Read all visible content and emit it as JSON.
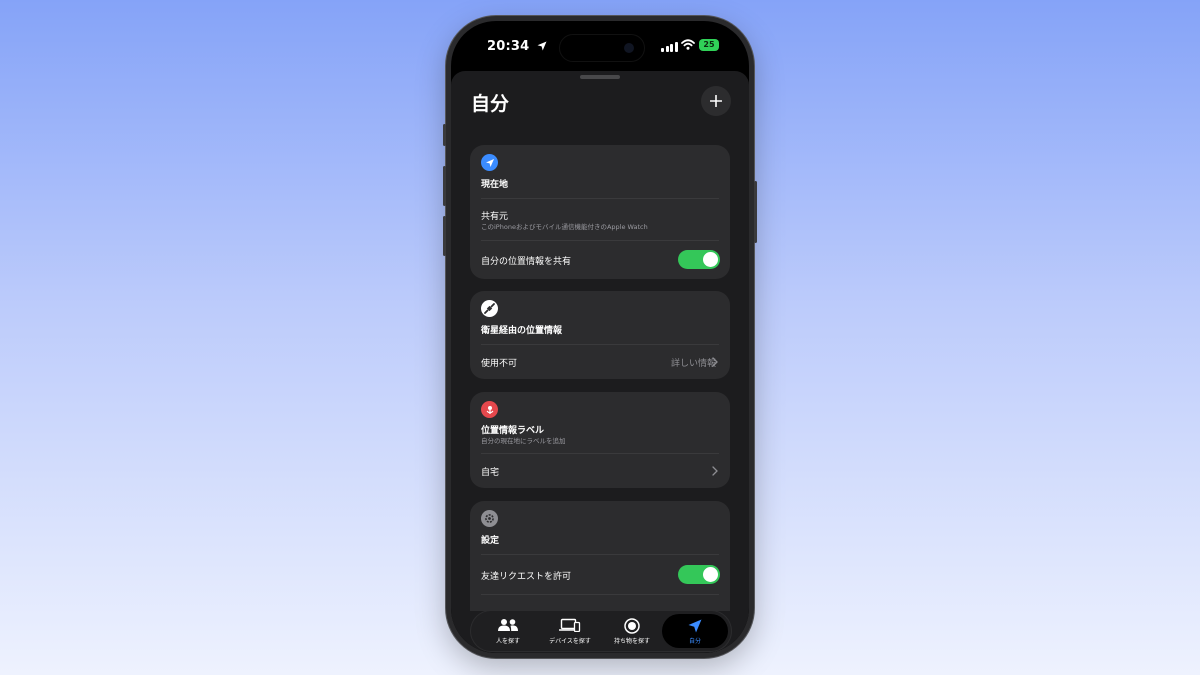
{
  "status_bar": {
    "time": "20:34",
    "battery": "25"
  },
  "sheet": {
    "title": "自分"
  },
  "cards": {
    "current_location": {
      "heading": "現在地",
      "shared_from_label": "共有元",
      "shared_from_detail": "このiPhoneおよびモバイル通信機能付きのApple Watch",
      "share_label": "自分の位置情報を共有",
      "share_enabled": true
    },
    "satellite": {
      "heading": "衛星経由の位置情報",
      "status_label": "使用不可",
      "details_link": "詳しい情報"
    },
    "location_label": {
      "heading": "位置情報ラベル",
      "subtitle": "自分の現在地にラベルを追加",
      "home_label": "自宅"
    },
    "settings": {
      "heading": "設定",
      "friend_requests_label": "友達リクエストを許可",
      "friend_requests_enabled": true
    }
  },
  "tabs": [
    {
      "label": "人を探す",
      "icon": "people-icon",
      "active": false
    },
    {
      "label": "デバイスを探す",
      "icon": "devices-icon",
      "active": false
    },
    {
      "label": "持ち物を探す",
      "icon": "airtag-icon",
      "active": false
    },
    {
      "label": "自分",
      "icon": "location-arrow-icon",
      "active": true
    }
  ],
  "colors": {
    "accent_blue": "#3b8cff",
    "toggle_green": "#34c759",
    "label_red": "#e5484d",
    "background_top": "#85a3f8",
    "background_bottom": "#eef2fe"
  }
}
